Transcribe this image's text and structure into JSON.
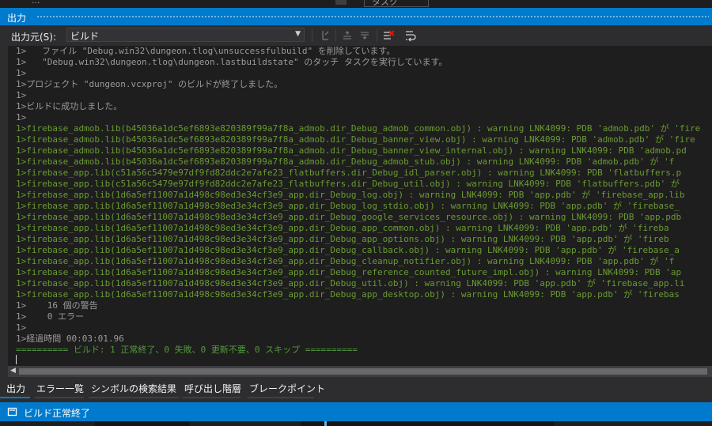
{
  "top_strip": {
    "left_text": "...",
    "right_text": "タスク"
  },
  "window": {
    "title": "出力"
  },
  "toolbar": {
    "source_label": "出力元(S):",
    "source_value": "ビルド",
    "buttons": [
      {
        "name": "find-message-icon"
      },
      {
        "name": "go-previous-message-icon"
      },
      {
        "name": "go-next-message-icon"
      },
      {
        "name": "clear-all-icon"
      },
      {
        "name": "toggle-word-wrap-icon"
      }
    ]
  },
  "output": {
    "lines": [
      {
        "text": "1>   ファイル \"Debug.win32\\dungeon.tlog\\unsuccessfulbuild\" を削除しています。",
        "kind": "info"
      },
      {
        "text": "1>   \"Debug.win32\\dungeon.tlog\\dungeon.lastbuildstate\" のタッチ タスクを実行しています。",
        "kind": "info"
      },
      {
        "text": "1>",
        "kind": "info"
      },
      {
        "text": "1>プロジェクト \"dungeon.vcxproj\" のビルドが終了しました。",
        "kind": "info"
      },
      {
        "text": "1>",
        "kind": "info"
      },
      {
        "text": "1>ビルドに成功しました。",
        "kind": "info"
      },
      {
        "text": "1>",
        "kind": "info"
      },
      {
        "text": "1>firebase_admob.lib(b45036a1dc5ef6893e820389f99a7f8a_admob.dir_Debug_admob_common.obj) : warning LNK4099: PDB 'admob.pdb' が 'fire",
        "kind": "warn"
      },
      {
        "text": "1>firebase_admob.lib(b45036a1dc5ef6893e820389f99a7f8a_admob.dir_Debug_banner_view.obj) : warning LNK4099: PDB 'admob.pdb' が 'fire",
        "kind": "warn"
      },
      {
        "text": "1>firebase_admob.lib(b45036a1dc5ef6893e820389f99a7f8a_admob.dir_Debug_banner_view_internal.obj) : warning LNK4099: PDB 'admob.pd",
        "kind": "warn"
      },
      {
        "text": "1>firebase_admob.lib(b45036a1dc5ef6893e820389f99a7f8a_admob.dir_Debug_admob_stub.obj) : warning LNK4099: PDB 'admob.pdb' が 'f",
        "kind": "warn"
      },
      {
        "text": "1>firebase_app.lib(c51a56c5479e97df9fd82ddc2e7afe23_flatbuffers.dir_Debug_idl_parser.obj) : warning LNK4099: PDB 'flatbuffers.p",
        "kind": "warn"
      },
      {
        "text": "1>firebase_app.lib(c51a56c5479e97df9fd82ddc2e7afe23_flatbuffers.dir_Debug_util.obj) : warning LNK4099: PDB 'flatbuffers.pdb' が",
        "kind": "warn"
      },
      {
        "text": "1>firebase_app.lib(1d6a5ef11007a1d498c98ed3e34cf3e9_app.dir_Debug_log.obj) : warning LNK4099: PDB 'app.pdb' が 'firebase_app.lib",
        "kind": "warn"
      },
      {
        "text": "1>firebase_app.lib(1d6a5ef11007a1d498c98ed3e34cf3e9_app.dir_Debug_log_stdio.obj) : warning LNK4099: PDB 'app.pdb' が 'firebase_",
        "kind": "warn"
      },
      {
        "text": "1>firebase_app.lib(1d6a5ef11007a1d498c98ed3e34cf3e9_app.dir_Debug_google_services_resource.obj) : warning LNK4099: PDB 'app.pdb",
        "kind": "warn"
      },
      {
        "text": "1>firebase_app.lib(1d6a5ef11007a1d498c98ed3e34cf3e9_app.dir_Debug_app_common.obj) : warning LNK4099: PDB 'app.pdb' が 'fireba",
        "kind": "warn"
      },
      {
        "text": "1>firebase_app.lib(1d6a5ef11007a1d498c98ed3e34cf3e9_app.dir_Debug_app_options.obj) : warning LNK4099: PDB 'app.pdb' が 'fireb",
        "kind": "warn"
      },
      {
        "text": "1>firebase_app.lib(1d6a5ef11007a1d498c98ed3e34cf3e9_app.dir_Debug_callback.obj) : warning LNK4099: PDB 'app.pdb' が 'firebase_a",
        "kind": "warn"
      },
      {
        "text": "1>firebase_app.lib(1d6a5ef11007a1d498c98ed3e34cf3e9_app.dir_Debug_cleanup_notifier.obj) : warning LNK4099: PDB 'app.pdb' が 'f",
        "kind": "warn"
      },
      {
        "text": "1>firebase_app.lib(1d6a5ef11007a1d498c98ed3e34cf3e9_app.dir_Debug_reference_counted_future_impl.obj) : warning LNK4099: PDB 'ap",
        "kind": "warn"
      },
      {
        "text": "1>firebase_app.lib(1d6a5ef11007a1d498c98ed3e34cf3e9_app.dir_Debug_util.obj) : warning LNK4099: PDB 'app.pdb' が 'firebase_app.li",
        "kind": "warn"
      },
      {
        "text": "1>firebase_app.lib(1d6a5ef11007a1d498c98ed3e34cf3e9_app.dir_Debug_app_desktop.obj) : warning LNK4099: PDB 'app.pdb' が 'firebas",
        "kind": "warn"
      },
      {
        "text": "1>    16 個の警告",
        "kind": "info"
      },
      {
        "text": "1>    0 エラー",
        "kind": "info"
      },
      {
        "text": "1>",
        "kind": "info"
      },
      {
        "text": "1>経過時間 00:03:01.96",
        "kind": "info"
      },
      {
        "text": "========== ビルド: 1 正常終了、0 失敗、0 更新不要、0 スキップ ==========",
        "kind": "success"
      }
    ]
  },
  "tabs": [
    {
      "label": "出力",
      "active": true
    },
    {
      "label": "エラー一覧",
      "active": false
    },
    {
      "label": "シンボルの検索結果",
      "active": false
    },
    {
      "label": "呼び出し階層",
      "active": false
    },
    {
      "label": "ブレークポイント",
      "active": false
    }
  ],
  "status": {
    "text": "ビルド正常終了",
    "icon": "build-status-icon"
  },
  "colors": {
    "accent": "#007acc",
    "warning_text": "#6a9a32",
    "success_text": "#519a3c",
    "info_text": "#9b9b9b"
  }
}
